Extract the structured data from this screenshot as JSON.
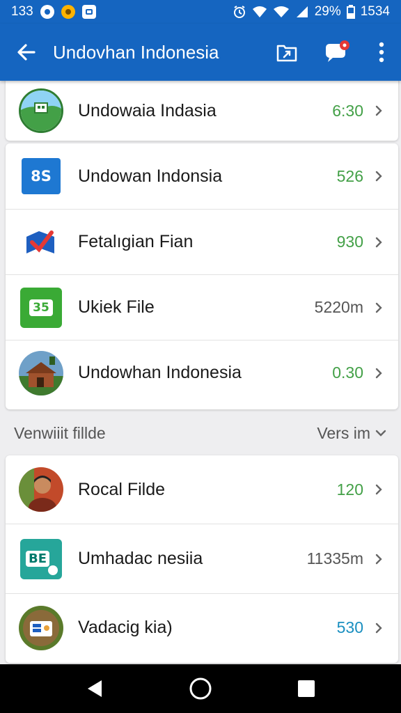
{
  "status_bar": {
    "time_left": "133",
    "battery_percent": "29%",
    "time_right": "1534",
    "icons": [
      "notification-icon",
      "app-icon",
      "screenshot-icon",
      "alarm-icon",
      "wifi-icon",
      "signal-icon",
      "battery-icon"
    ]
  },
  "app_bar": {
    "title": "Undovhan Indonesia",
    "back_icon": "arrow-left-icon",
    "actions": [
      "share-folder-icon",
      "chat-bubble-icon",
      "more-vert-icon"
    ],
    "badge_color": "#e53935",
    "color": "#1565c0"
  },
  "list_top": [
    {
      "label": "Undowaia Indasia",
      "value": "6:30",
      "icon": "landscape-avatar",
      "value_color": "green"
    }
  ],
  "list_main": [
    {
      "label": "Undowan Indonsia",
      "value": "526",
      "icon": "folder-8s-icon",
      "value_color": "green"
    },
    {
      "label": "Fetalıgian Fian",
      "value": "930",
      "icon": "checkmark-flag-icon",
      "value_color": "green"
    },
    {
      "label": "Ukiek File",
      "value": "5220m",
      "icon": "green-doc-icon",
      "tile_text": "35",
      "value_color": "gray"
    },
    {
      "label": "Undowhan Indonesia",
      "value": "0.30",
      "icon": "house-avatar",
      "value_color": "green"
    }
  ],
  "folder_tile_text": "8S",
  "section": {
    "title": "Venwiiit fillde",
    "select_label": "Vers im"
  },
  "list_bottom": [
    {
      "label": "Rocal Filde",
      "value": "120",
      "icon": "person-avatar",
      "value_color": "green"
    },
    {
      "label": "Umhadac nesiia",
      "value": "11335m",
      "icon": "teal-file-icon",
      "tile_text": "BE",
      "value_color": "gray"
    },
    {
      "label": "Vadacig kia)",
      "value": "530",
      "icon": "nature-avatar",
      "value_color": "teal"
    }
  ],
  "nav_bar": [
    "back-triangle-icon",
    "home-circle-icon",
    "recents-square-icon"
  ]
}
